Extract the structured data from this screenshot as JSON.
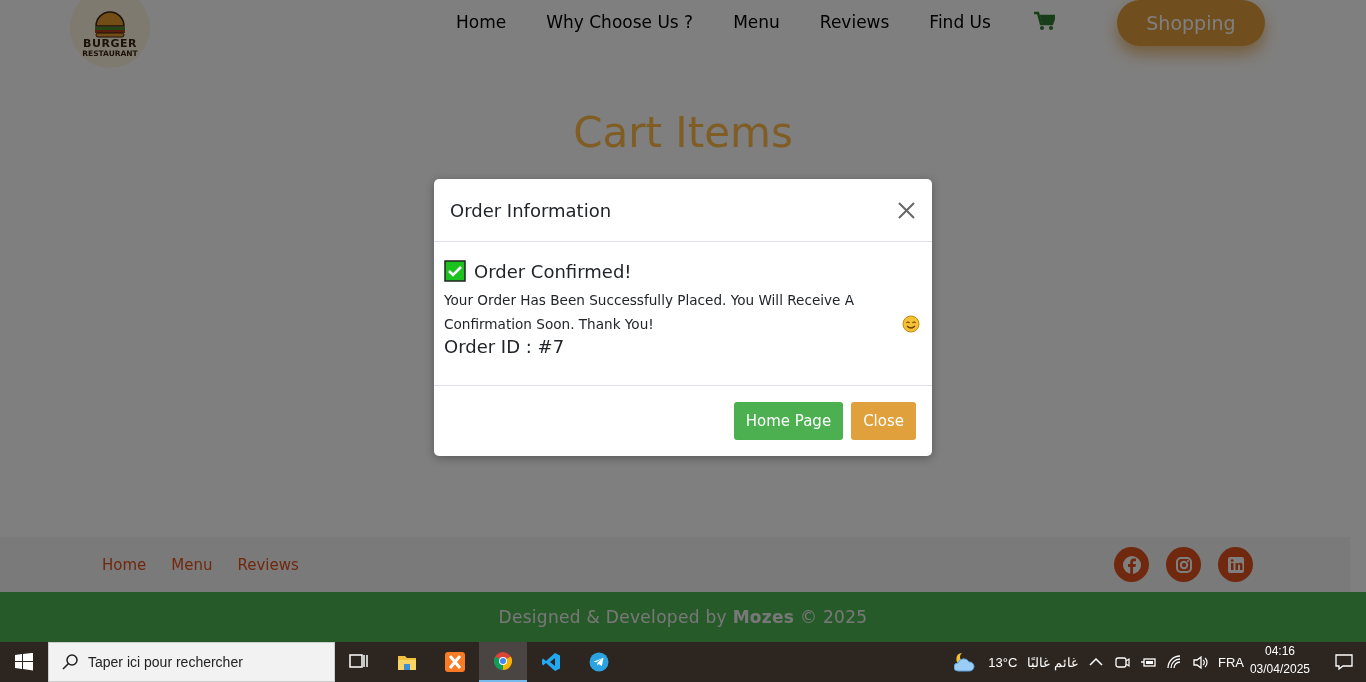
{
  "header": {
    "logo": {
      "title": "BURGER",
      "subtitle": "RESTAURANT"
    },
    "nav": [
      {
        "label": "Home"
      },
      {
        "label": "Why Choose Us ?"
      },
      {
        "label": "Menu"
      },
      {
        "label": "Reviews"
      },
      {
        "label": "Find Us"
      }
    ],
    "shopping_button": "Shopping"
  },
  "page_title": "Cart Items",
  "modal": {
    "title": "Order Information",
    "heading": "Order Confirmed!",
    "message": "Your Order Has Been Successfully Placed. You Will Receive A Confirmation Soon. Thank You!",
    "order_id": "Order ID : #7",
    "buttons": [
      {
        "label": "Home Page",
        "kind": "primary"
      },
      {
        "label": "Close",
        "kind": "secondary"
      }
    ]
  },
  "footer": {
    "links": [
      "Home",
      "Menu",
      "Reviews"
    ],
    "social": [
      {
        "kind": "facebook"
      },
      {
        "kind": "instagram"
      },
      {
        "kind": "linkedin"
      }
    ],
    "credit": "Designed & Developed by **Mozes** © 2025"
  },
  "taskbar": {
    "search_placeholder": "Taper ici pour rechercher",
    "apps": [
      {
        "kind": "task-view",
        "selected": false
      },
      {
        "kind": "folder",
        "selected": false
      },
      {
        "kind": "xampp",
        "selected": false
      },
      {
        "kind": "chrome",
        "selected": true
      },
      {
        "kind": "vscode",
        "selected": false
      },
      {
        "kind": "telegram",
        "selected": false
      }
    ],
    "temperature": "13°C",
    "weather": "غائم غالبًا",
    "language": "FRA",
    "time": "04:16",
    "date": "03/04/2025"
  }
}
